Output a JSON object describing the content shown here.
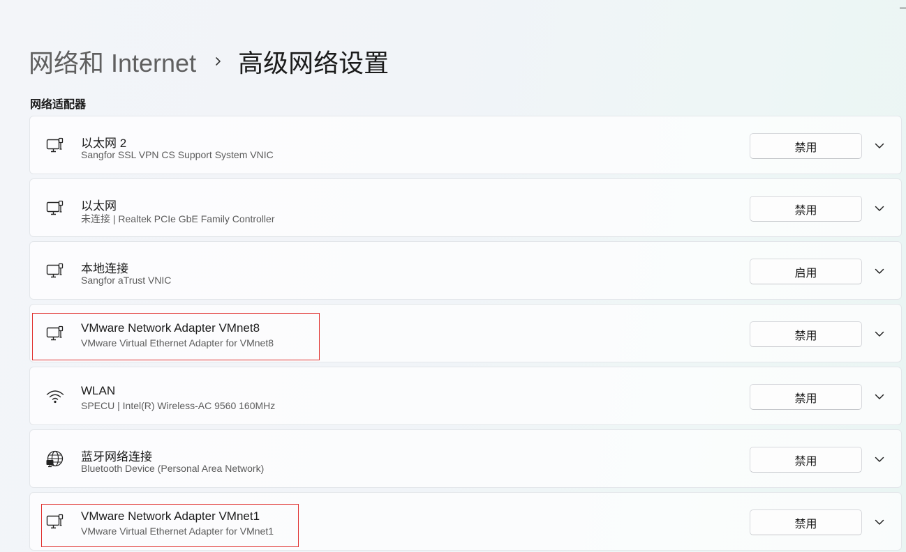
{
  "breadcrumb": {
    "parent": "网络和 Internet",
    "separator_icon": "chevron-right-icon",
    "current": "高级网络设置"
  },
  "section": {
    "title": "网络适配器"
  },
  "adapters": [
    {
      "name": "以太网 2",
      "description": "Sangfor SSL VPN CS Support System VNIC",
      "icon": "ethernet-icon",
      "action": "禁用",
      "highlighted": false
    },
    {
      "name": "以太网",
      "description": "未连接 | Realtek PCIe GbE Family Controller",
      "icon": "ethernet-icon",
      "action": "禁用",
      "highlighted": false
    },
    {
      "name": "本地连接",
      "description": "Sangfor aTrust VNIC",
      "icon": "ethernet-icon",
      "action": "启用",
      "highlighted": false
    },
    {
      "name": "VMware Network Adapter VMnet8",
      "description": "VMware Virtual Ethernet Adapter for VMnet8",
      "icon": "ethernet-icon",
      "action": "禁用",
      "highlighted": true
    },
    {
      "name": "WLAN",
      "description": "SPECU | Intel(R) Wireless-AC 9560 160MHz",
      "icon": "wifi-icon",
      "action": "禁用",
      "highlighted": false
    },
    {
      "name": "蓝牙网络连接",
      "description": "Bluetooth Device (Personal Area Network)",
      "icon": "globe-network-icon",
      "action": "禁用",
      "highlighted": false
    },
    {
      "name": "VMware Network Adapter VMnet1",
      "description": "VMware Virtual Ethernet Adapter for VMnet1",
      "icon": "ethernet-icon",
      "action": "禁用",
      "highlighted": true
    }
  ],
  "colors": {
    "highlight_border": "#e0302e",
    "card_background": "#ffffff"
  }
}
